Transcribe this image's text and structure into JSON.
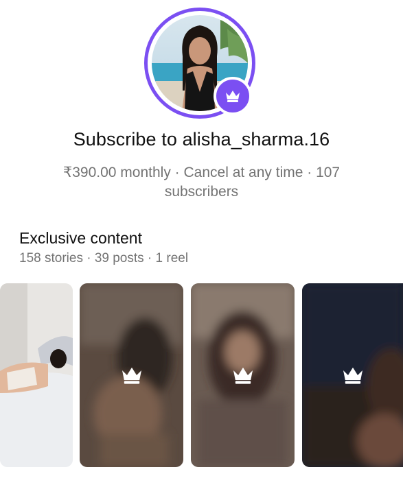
{
  "colors": {
    "accent": "#7b4ff2",
    "muted_text": "#737373"
  },
  "profile": {
    "avatar_alt": "profile photo",
    "badge_icon": "crown-icon"
  },
  "subscribe": {
    "title": "Subscribe to alisha_sharma.16",
    "price_line": "₹390.00 monthly · Cancel at any time · 107 subscribers"
  },
  "exclusive": {
    "heading": "Exclusive content",
    "counts": "158 stories · 39 posts · 1 reel"
  },
  "thumbnails": [
    {
      "kind": "preview",
      "locked": false
    },
    {
      "kind": "locked",
      "locked": true,
      "icon": "crown-icon"
    },
    {
      "kind": "locked",
      "locked": true,
      "icon": "crown-icon"
    },
    {
      "kind": "locked",
      "locked": true,
      "icon": "crown-icon"
    }
  ]
}
